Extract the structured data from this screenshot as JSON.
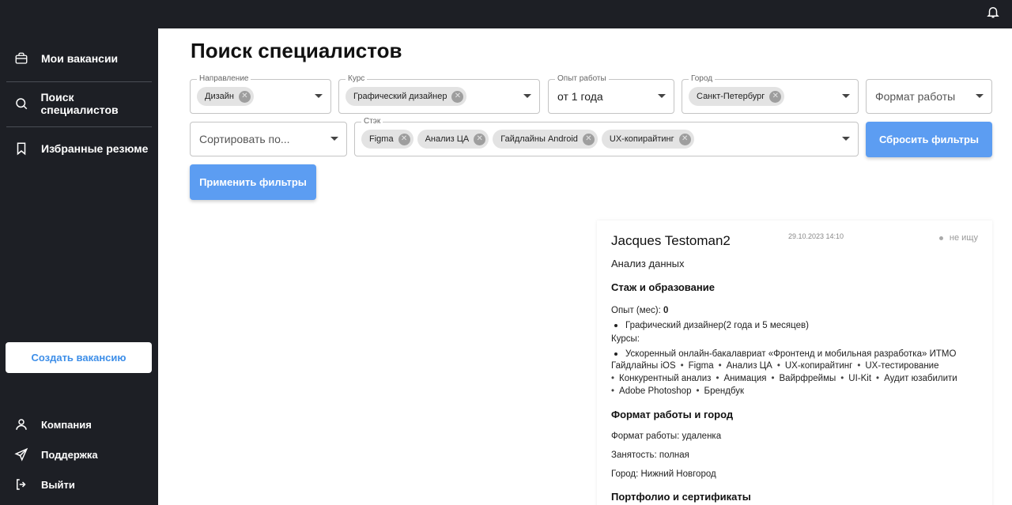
{
  "sidebar": {
    "items": [
      {
        "label": "Мои вакансии",
        "icon": "briefcase-icon"
      },
      {
        "label": "Поиск специалистов",
        "icon": "search-icon"
      },
      {
        "label": "Избранные резюме",
        "icon": "bookmark-icon"
      }
    ],
    "create_button": "Создать вакансию",
    "bottom": [
      {
        "label": "Компания",
        "icon": "user-icon"
      },
      {
        "label": "Поддержка",
        "icon": "send-icon"
      },
      {
        "label": "Выйти",
        "icon": "logout-icon"
      }
    ]
  },
  "header": {
    "bell_icon": "bell-icon"
  },
  "page": {
    "title": "Поиск специалистов"
  },
  "filters": {
    "direction": {
      "label": "Направление",
      "chips": [
        "Дизайн"
      ]
    },
    "course": {
      "label": "Курс",
      "chips": [
        "Графический дизайнер"
      ]
    },
    "experience": {
      "label": "Опыт работы",
      "value": "от 1 года"
    },
    "city": {
      "label": "Город",
      "chips": [
        "Санкт-Петербург"
      ]
    },
    "work_format": {
      "placeholder": "Формат работы"
    },
    "sort": {
      "placeholder": "Сортировать по..."
    },
    "stack": {
      "label": "Стэк",
      "chips": [
        "Figma",
        "Анализ ЦА",
        "Гайдлайны Android",
        "UX-копирайтинг"
      ]
    },
    "reset_button": "Сбросить фильтры",
    "apply_button": "Применить фильтры"
  },
  "candidate": {
    "name": "Jacques Testoman2",
    "date": "29.10.2023 14:10",
    "status": "не ищу",
    "role": "Анализ данных",
    "section_experience": "Стаж и образование",
    "experience_label": "Опыт (мес):",
    "experience_value": "0",
    "education": "Графический дизайнер(2 года и 5 месяцев)",
    "courses_label": "Курсы:",
    "course": "Ускоренный онлайн-бакалавриат «Фронтенд и мобильная разработка» ИТМО",
    "skills_line1": [
      "Гайдлайны iOS",
      "Figma",
      "Анализ ЦА",
      "UX-копирайтинг",
      "UX-тестирование"
    ],
    "skills_line2": [
      "Конкурентный анализ",
      "Анимация",
      "Вайрфреймы",
      "UI-Kit",
      "Аудит юзабилити"
    ],
    "skills_line3": [
      "Adobe Photoshop",
      "Брендбук"
    ],
    "section_format": "Формат работы и город",
    "work_format": "Формат работы: удаленка",
    "employment": "Занятость: полная",
    "city": "Город: Нижний Новгород",
    "section_portfolio": "Портфолио и сертификаты"
  },
  "colors": {
    "sidebar_bg": "#1d1f25",
    "accent": "#5c9df2",
    "create_text": "#3d8ee8"
  }
}
